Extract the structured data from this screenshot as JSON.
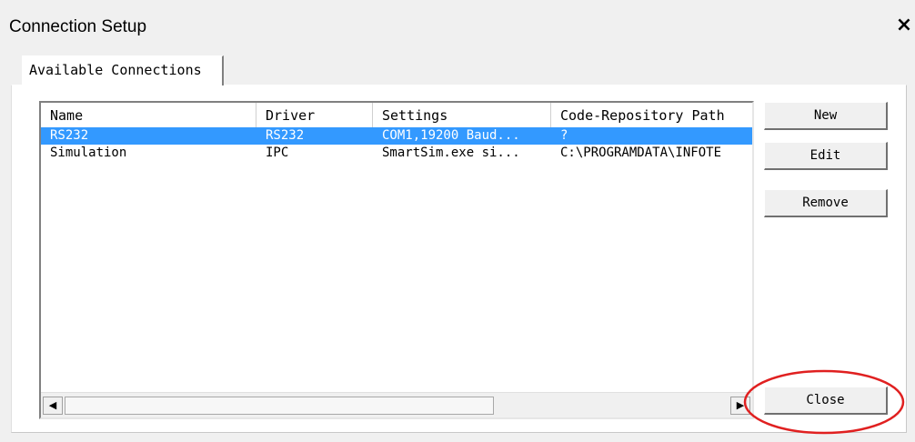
{
  "window": {
    "title": "Connection Setup",
    "close_glyph": "×"
  },
  "tabs": [
    {
      "label": "Available Connections"
    }
  ],
  "table": {
    "columns": [
      "Name",
      "Driver",
      "Settings",
      "Code-Repository Path"
    ],
    "rows": [
      {
        "name": "RS232",
        "driver": "RS232",
        "settings": "COM1,19200 Baud...",
        "path": "?",
        "selected": true
      },
      {
        "name": "Simulation",
        "driver": "IPC",
        "settings": "SmartSim.exe si...",
        "path": "C:\\PROGRAMDATA\\INFOTE",
        "selected": false
      }
    ]
  },
  "scrollbar": {
    "left_glyph": "◀",
    "right_glyph": "▶"
  },
  "buttons": {
    "new": "New",
    "edit": "Edit",
    "remove": "Remove",
    "close": "Close"
  },
  "annotation": {
    "color": "#e02020"
  }
}
